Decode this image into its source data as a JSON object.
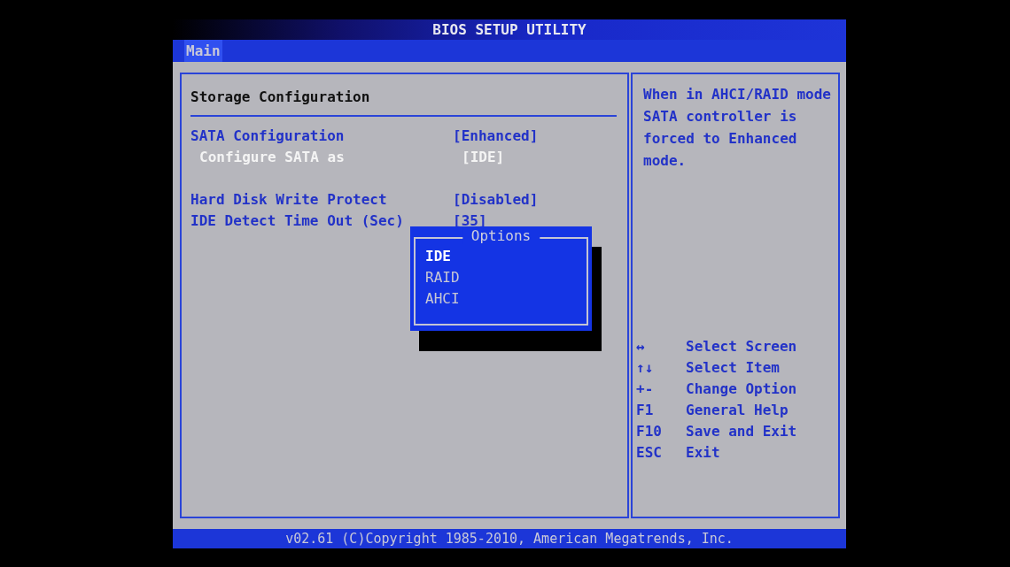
{
  "window": {
    "title": "BIOS SETUP UTILITY"
  },
  "tabs": [
    {
      "label": "Main",
      "selected": true
    }
  ],
  "section": {
    "title": "Storage Configuration"
  },
  "setting_groups": [
    [
      {
        "label": "SATA Configuration",
        "value": "[Enhanced]",
        "selected": false
      },
      {
        "label": "Configure SATA as",
        "value": "[IDE]",
        "selected": true
      }
    ],
    [
      {
        "label": "Hard Disk Write Protect",
        "value": "[Disabled]",
        "selected": false
      },
      {
        "label": "IDE Detect Time Out (Sec)",
        "value": "[35]",
        "selected": false
      }
    ]
  ],
  "options_popup": {
    "title": "Options",
    "items": [
      {
        "label": "IDE",
        "selected": true
      },
      {
        "label": "RAID",
        "selected": false
      },
      {
        "label": "AHCI",
        "selected": false
      }
    ]
  },
  "help_text": "When in AHCI/RAID mode SATA controller is forced to Enhanced mode.",
  "key_legend": [
    {
      "key": "↔",
      "action": "Select Screen"
    },
    {
      "key": "↑↓",
      "action": "Select Item"
    },
    {
      "key": "+-",
      "action": "Change Option"
    },
    {
      "key": "F1",
      "action": "General Help"
    },
    {
      "key": "F10",
      "action": "Save and Exit"
    },
    {
      "key": "ESC",
      "action": "Exit"
    }
  ],
  "status_bar": "v02.61 (C)Copyright 1985-2010, American Megatrends, Inc."
}
